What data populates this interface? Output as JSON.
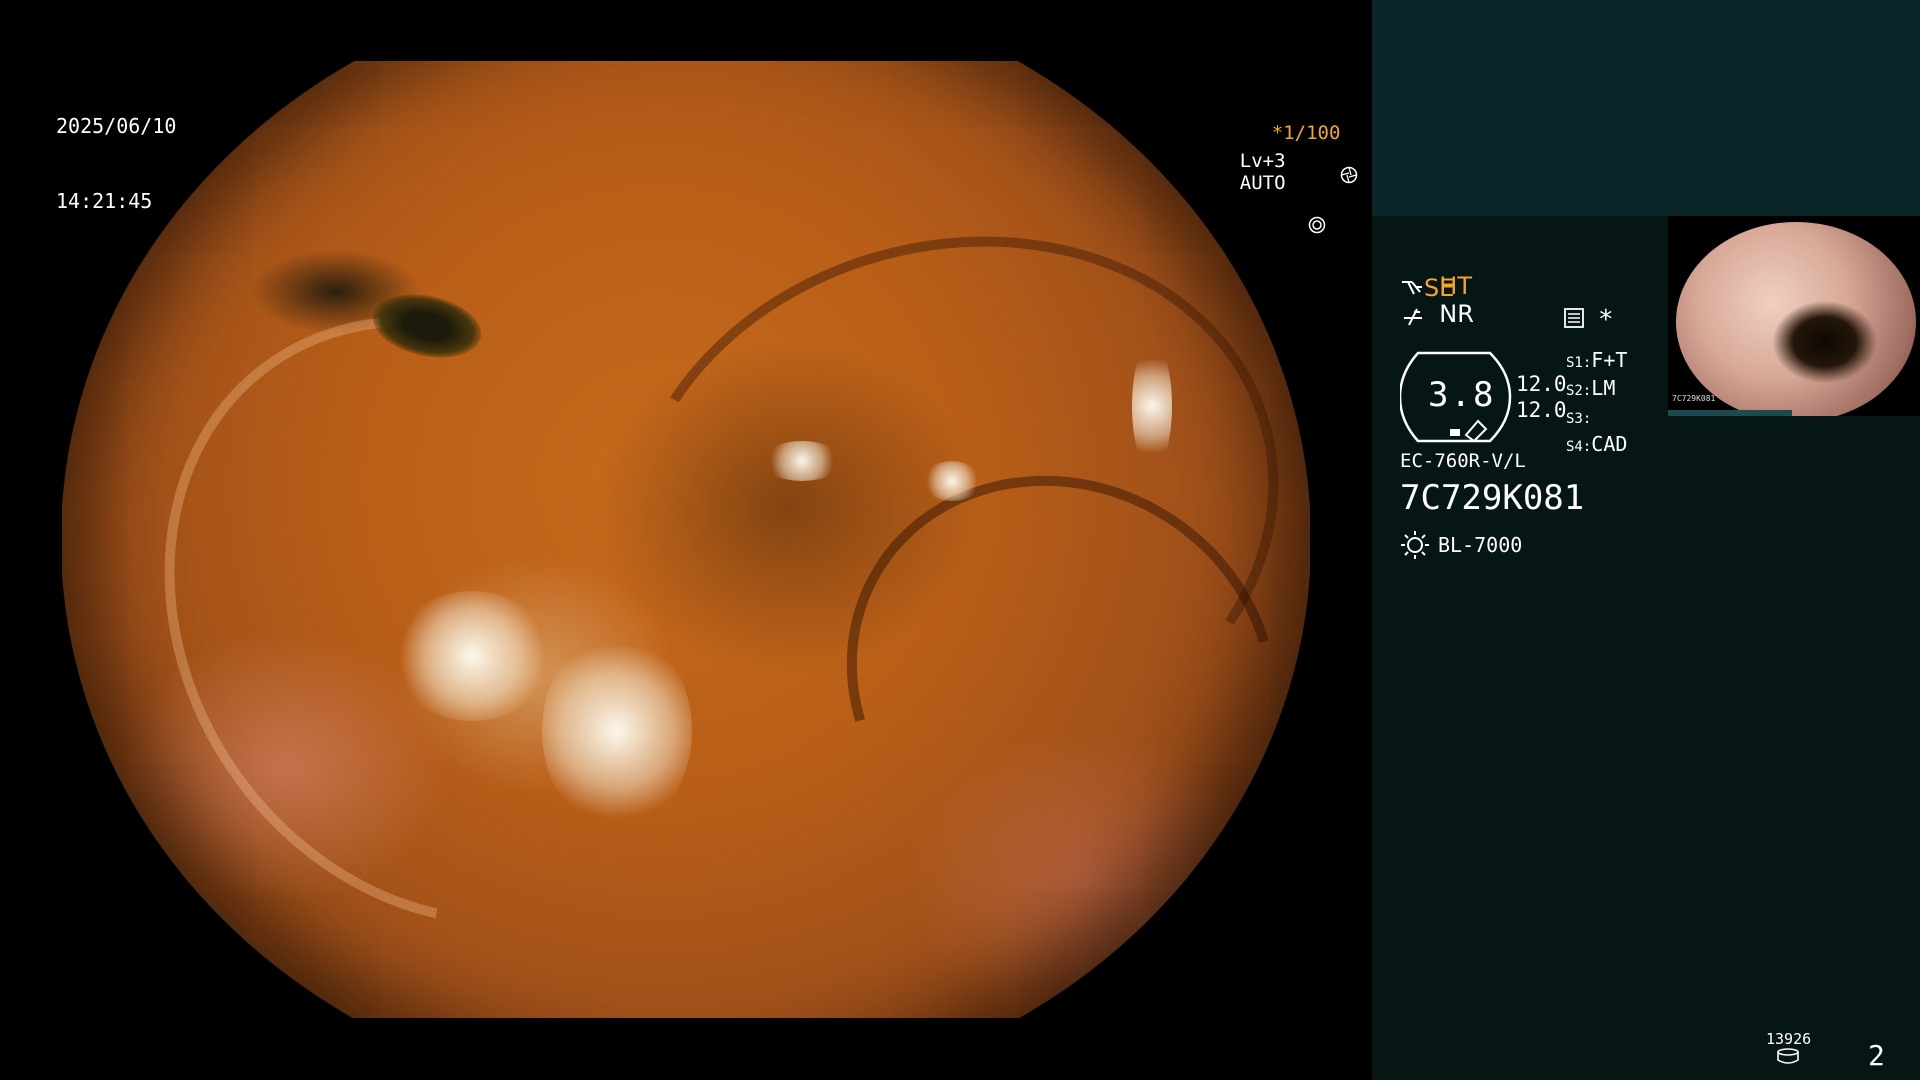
{
  "overlay": {
    "date": "2025/06/10",
    "time": "14:21:45",
    "shutter": "*1/100",
    "shutter_icon": "aperture-icon",
    "level": "Lv+3",
    "mode": "AUTO",
    "mode_icon": "exposure-icon"
  },
  "panel": {
    "ht_label": "HT",
    "nr_label": "NR",
    "se_label": "SE",
    "menu_star": "*",
    "scope_ratio": "3.8",
    "value_a": "12.0",
    "value_b": "12.0",
    "s1_label": "S1:",
    "s1_value": "F+T",
    "s2_label": "S2:",
    "s2_value": "LM",
    "s3_label": "S3:",
    "s3_value": "",
    "s4_label": "S4:",
    "s4_value": "CAD",
    "scope_model": "EC-760R-V/L",
    "scope_serial": "7C729K081",
    "light_source": "BL-7000",
    "thumbnail_label": "7C729K081",
    "storage_count": "13926",
    "page_number": "2"
  },
  "colors": {
    "accent": "#f5a623",
    "panel_top": "#0b2628",
    "panel_bg": "#061615",
    "text": "#ffffff"
  }
}
